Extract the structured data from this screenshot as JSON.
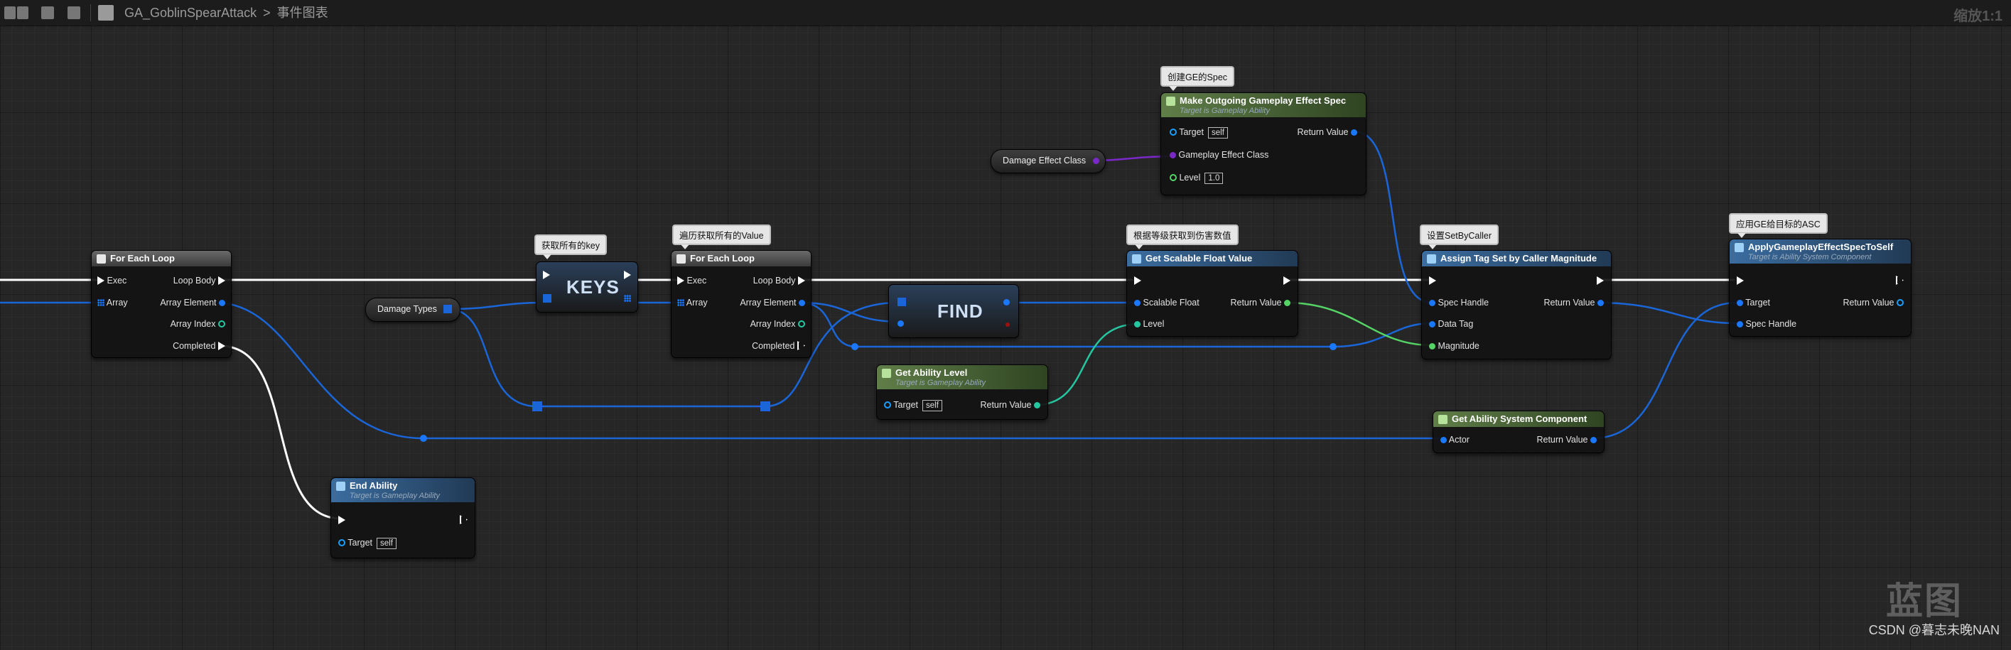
{
  "breadcrumb": {
    "asset": "GA_GoblinSpearAttack",
    "separator": ">",
    "graph": "事件图表",
    "zoom": "缩放1:1"
  },
  "comments": {
    "spec": "创建GE的Spec",
    "keys": "获取所有的key",
    "values": "遍历获取所有的Value",
    "damage": "根据等级获取到伤害数值",
    "setbycaller": "设置SetByCaller",
    "apply": "应用GE给目标的ASC"
  },
  "nodes": {
    "foreach1": {
      "title": "For Each Loop",
      "exec": "Exec",
      "array": "Array",
      "loop_body": "Loop Body",
      "array_element": "Array Element",
      "array_index": "Array Index",
      "completed": "Completed"
    },
    "foreach2": {
      "title": "For Each Loop",
      "exec": "Exec",
      "array": "Array",
      "loop_body": "Loop Body",
      "array_element": "Array Element",
      "array_index": "Array Index",
      "completed": "Completed"
    },
    "keys": {
      "title": "KEYS"
    },
    "find": {
      "title": "FIND"
    },
    "damage_types": {
      "label": "Damage Types"
    },
    "damage_effect_class": {
      "label": "Damage Effect Class"
    },
    "end_ability": {
      "title": "End Ability",
      "subtitle": "Target is Gameplay Ability",
      "target": "Target",
      "self": "self"
    },
    "make_spec": {
      "title": "Make Outgoing Gameplay Effect Spec",
      "subtitle": "Target is Gameplay Ability",
      "target": "Target",
      "self": "self",
      "effect_class": "Gameplay Effect Class",
      "level": "Level",
      "level_value": "1.0",
      "return": "Return Value"
    },
    "get_ability_level": {
      "title": "Get Ability Level",
      "subtitle": "Target is Gameplay Ability",
      "target": "Target",
      "self": "self",
      "return": "Return Value"
    },
    "scalable": {
      "title": "Get Scalable Float Value",
      "scalable": "Scalable Float",
      "level": "Level",
      "return": "Return Value"
    },
    "assign_tag": {
      "title": "Assign Tag Set by Caller Magnitude",
      "spec_handle": "Spec Handle",
      "data_tag": "Data Tag",
      "magnitude": "Magnitude",
      "return": "Return Value"
    },
    "get_asc": {
      "title": "Get Ability System Component",
      "actor": "Actor",
      "return": "Return Value"
    },
    "apply": {
      "title": "ApplyGameplayEffectSpecToSelf",
      "subtitle": "Target is Ability System Component",
      "target": "Target",
      "spec_handle": "Spec Handle",
      "return": "Return Value"
    }
  },
  "watermark": {
    "logo": "蓝图",
    "text": "CSDN @暮志未晚NAN"
  },
  "colors": {
    "exec": "#ffffff",
    "struct": "#1a78ff",
    "float": "#55d466",
    "int": "#25c7a0",
    "class": "#7a28c8"
  }
}
